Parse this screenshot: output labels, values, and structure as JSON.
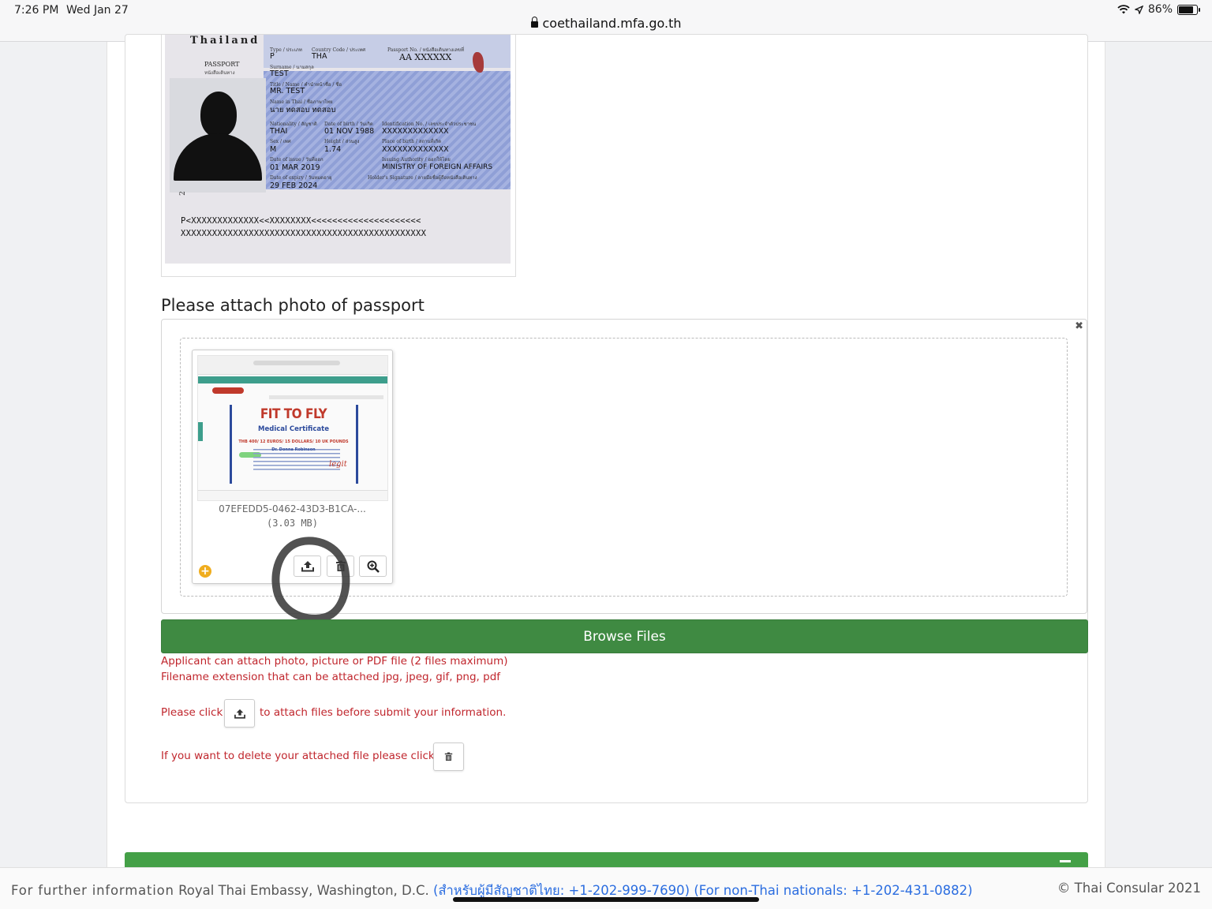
{
  "statusbar": {
    "time": "7:26 PM",
    "date": "Wed Jan 27",
    "battery": "86%"
  },
  "browser": {
    "url": "coethailand.mfa.go.th"
  },
  "passport": {
    "country": "Thailand",
    "doc_label": "PASSPORT",
    "doc_label_thai": "หนังสือเดินทาง",
    "type_label": "Type / ประเภท",
    "type": "P",
    "country_code_label": "Country Code / ประเทศ",
    "country_code": "THA",
    "passport_no_label": "Passport No. / หนังสือเดินทางเลขที่",
    "passport_no": "AA XXXXXX",
    "surname_label": "Surname / นามสกุล",
    "surname": "TEST",
    "name_label": "Title / Name / คำนำหน้าชื่อ / ชื่อ",
    "name": "MR. TEST",
    "name_thai_label": "Name in Thai / ชื่อภาษาไทย",
    "name_thai": "นาย ทดสอบ ทดสอบ",
    "nationality_label": "Nationality / สัญชาติ",
    "nationality": "THAI",
    "dob_label": "Date of birth / วันเกิด",
    "dob": "01 NOV 1988",
    "id_label": "Identification No. / เลขประจำตัวประชาชน",
    "id": "XXXXXXXXXXXXX",
    "sex_label": "Sex / เพศ",
    "sex": "M",
    "height_label": "Height / ส่วนสูง",
    "height": "1.74",
    "pob_label": "Place of birth / สถานที่เกิด",
    "pob": "XXXXXXXXXXXXX",
    "issue_label": "Date of issue / วันที่ออก",
    "issue": "01 MAR 2019",
    "authority_label": "Issuing Authority / ออกให้โดย",
    "authority": "MINISTRY OF FOREIGN AFFAIRS",
    "expiry_label": "Date of expiry / วันหมดอายุ",
    "expiry": "29 FEB 2024",
    "signature_label": "Holder's Signature / ลายมือชื่อผู้ถือหนังสือเดินทาง",
    "side_number": "2",
    "mrz1": "P<XXXXXXXXXXXXX<<XXXXXXXX<<<<<<<<<<<<<<<<<<<<<",
    "mrz2": "XXXXXXXXXXXXXXXXXXXXXXXXXXXXXXXXXXXXXXXXXXXXXXX"
  },
  "upload": {
    "section_title": "Please attach photo of passport",
    "close_label": "✖",
    "file": {
      "name": "07EFEDD5-0462-43D3-B1CA-...",
      "size": "(3.03 MB)",
      "preview": {
        "title": "FIT TO FLY",
        "subtitle": "Medical Certificate",
        "price": "THB 400/ 12 EUROS/ 15 DOLLARS/ 10 UK POUNDS",
        "doctor": "Dr. Donna Robinson",
        "brand": "legit"
      }
    },
    "badge": "+",
    "browse_label": "Browse Files"
  },
  "notes": {
    "line1": "Applicant can attach photo, picture or PDF file (2 files maximum)",
    "line2": "Filename extension that can be attached jpg, jpeg, gif, png, pdf",
    "click_prefix": "Please click",
    "click_suffix": "to attach files before submit your information.",
    "delete_text": "If you want to delete your attached file please click"
  },
  "footer": {
    "label": "For further information",
    "embassy": "Royal Thai Embassy, Washington, D.C.",
    "phones": "(สำหรับผู้มีสัญชาติไทย: +1-202-999-7690) (For non-Thai nationals: +1-202-431-0882)",
    "copyright": "© Thai Consular 2021"
  },
  "colors": {
    "primary_green": "#3f8a42",
    "note_red": "#c0262d",
    "link_blue": "#2b6de0"
  }
}
